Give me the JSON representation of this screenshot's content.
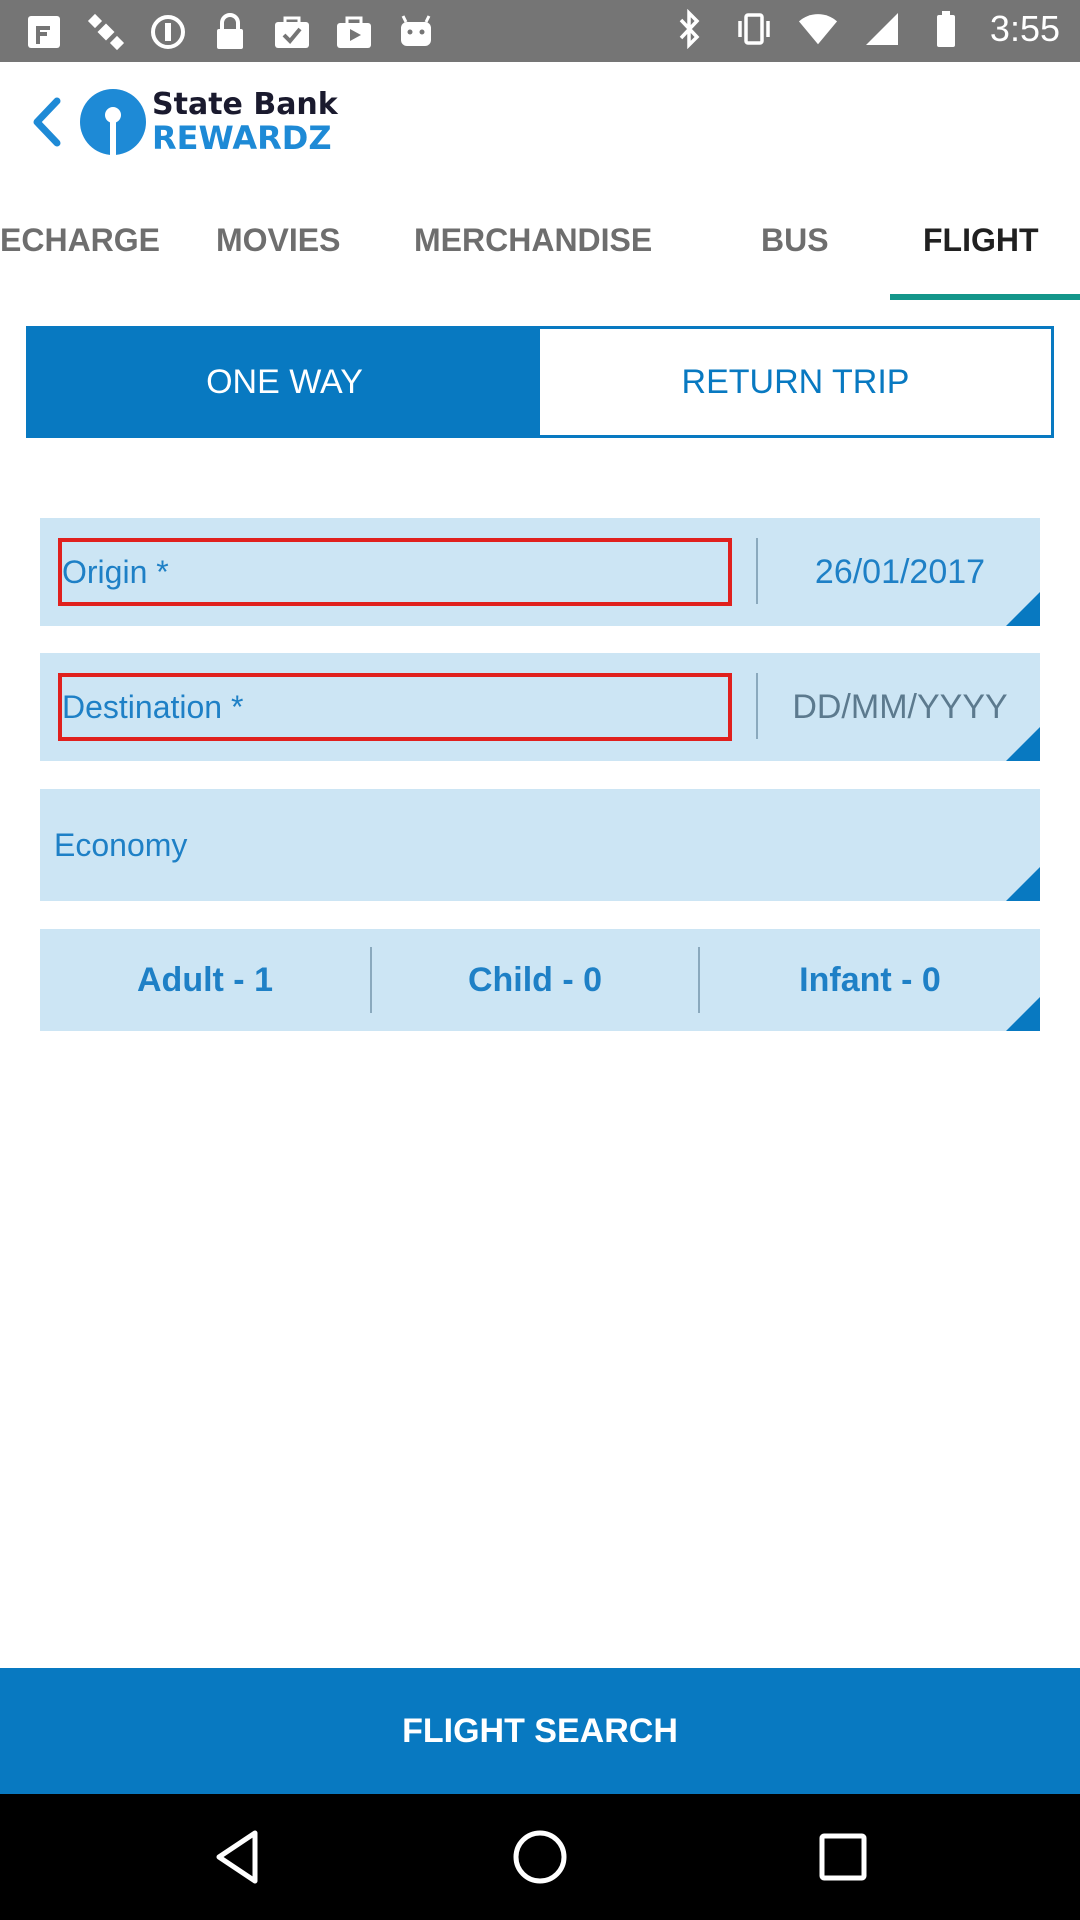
{
  "status_bar": {
    "time": "3:55",
    "left_icons": [
      "fake-gps-icon",
      "satellite-icon",
      "block-icon",
      "lock-icon",
      "shopping-bag-check-icon",
      "briefcase-icon",
      "play-store-icon",
      "android-icon"
    ],
    "right_icons": [
      "bluetooth-icon",
      "vibrate-icon",
      "wifi-icon",
      "signal-icon",
      "battery-icon"
    ]
  },
  "header": {
    "logo_line1": "State Bank",
    "logo_line2": "REWARDZ"
  },
  "tabs": [
    {
      "label": "ECHARGE",
      "active": false
    },
    {
      "label": "MOVIES",
      "active": false
    },
    {
      "label": "MERCHANDISE",
      "active": false
    },
    {
      "label": "BUS",
      "active": false
    },
    {
      "label": "FLIGHT",
      "active": true
    }
  ],
  "trip_type": {
    "one_way": "ONE WAY",
    "return_trip": "RETURN TRIP",
    "selected": "ONE WAY"
  },
  "form": {
    "origin_placeholder": "Origin *",
    "departure_date": "26/01/2017",
    "destination_placeholder": "Destination *",
    "return_date_placeholder": "DD/MM/YYYY",
    "travel_class": "Economy",
    "passengers": {
      "adult": "Adult -  1",
      "child": "Child -  0",
      "infant": "Infant -  0"
    }
  },
  "search_button": "FLIGHT SEARCH",
  "colors": {
    "primary": "#0879c1",
    "field_bg": "#cce5f4",
    "tab_indicator": "#14968a",
    "error_border": "#e0201d"
  }
}
